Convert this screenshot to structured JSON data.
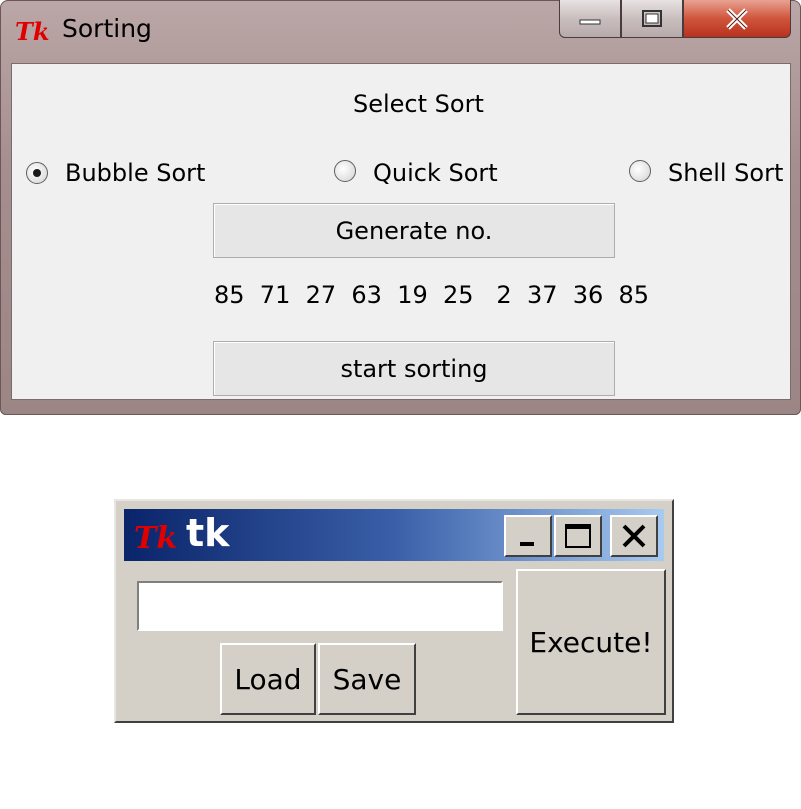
{
  "sorting_window": {
    "title": "Sorting",
    "heading": "Select Sort",
    "options": [
      {
        "label": "Bubble Sort",
        "selected": true
      },
      {
        "label": "Quick Sort",
        "selected": false
      },
      {
        "label": "Shell Sort",
        "selected": false
      }
    ],
    "generate_button": "Generate no.",
    "numbers": "85  71  27  63  19  25   2  37  36  85",
    "start_button": "start sorting"
  },
  "tk_window": {
    "title": "tk",
    "entry_value": "",
    "load_button": "Load",
    "save_button": "Save",
    "execute_button": "Execute!"
  }
}
